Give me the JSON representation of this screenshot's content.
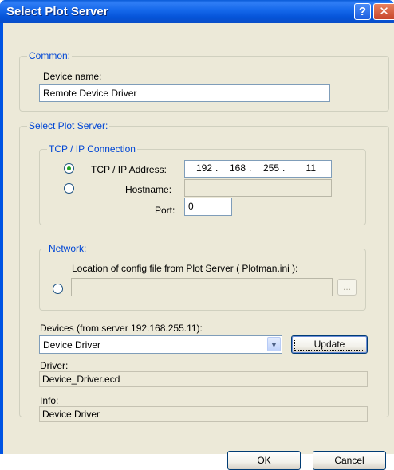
{
  "window": {
    "title": "Select Plot Server",
    "help_glyph": "?",
    "close_glyph": "✕"
  },
  "common": {
    "legend": "Common:",
    "device_name_label": "Device name:",
    "device_name_value": "Remote Device Driver"
  },
  "select_plot_server": {
    "legend": "Select Plot Server:",
    "tcp": {
      "legend": "TCP / IP Connection",
      "ip_address_label": "TCP / IP Address:",
      "ip_octets": [
        "192",
        "168",
        "255",
        "11"
      ],
      "ip_separator": ".",
      "hostname_label": "Hostname:",
      "hostname_value": "",
      "port_label": "Port:",
      "port_value": "0",
      "selected": "ip_address"
    },
    "network": {
      "legend": "Network:",
      "config_label": "Location of config file from Plot Server ( Plotman.ini ):",
      "config_value": "",
      "browse_label": "..."
    }
  },
  "devices": {
    "label": "Devices (from server 192.168.255.11):",
    "selected": "Device Driver",
    "update_label": "Update"
  },
  "driver": {
    "label": "Driver:",
    "value": "Device_Driver.ecd"
  },
  "info": {
    "label": "Info:",
    "value": "Device Driver"
  },
  "buttons": {
    "ok": "OK",
    "cancel": "Cancel"
  },
  "colors": {
    "title_bar": "#0054e3",
    "dialog_face": "#ece9d8",
    "group_label": "#0046d5",
    "radio_dot": "#21a121"
  }
}
